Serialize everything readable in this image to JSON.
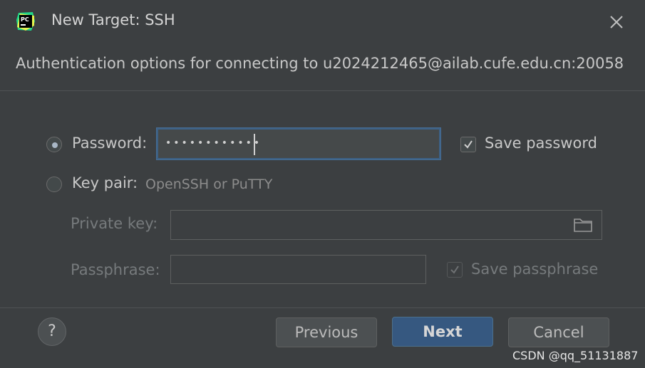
{
  "window": {
    "title": "New Target: SSH",
    "app_logo_text": "PC"
  },
  "subtitle": "Authentication options for connecting to u2024212465@ailab.cufe.edu.cn:20058",
  "auth": {
    "password_label": "Password:",
    "password_value": "••••••••••••",
    "save_password_label": "Save password",
    "save_password_checked": true,
    "keypair_label": "Key pair:",
    "keypair_hint": "OpenSSH or PuTTY",
    "private_key_label": "Private key:",
    "private_key_value": "",
    "passphrase_label": "Passphrase:",
    "passphrase_value": "",
    "save_passphrase_label": "Save passphrase",
    "save_passphrase_checked": true,
    "selected": "password"
  },
  "footer": {
    "help_label": "?",
    "previous_label": "Previous",
    "next_label": "Next",
    "cancel_label": "Cancel"
  },
  "watermark": "CSDN @qq_51131887",
  "colors": {
    "accent": "#365880",
    "focus_border": "#3d6185",
    "background": "#3c3f41"
  },
  "icons": [
    "pycharm-logo-icon",
    "close-icon",
    "folder-icon",
    "help-icon",
    "checkmark-icon"
  ]
}
